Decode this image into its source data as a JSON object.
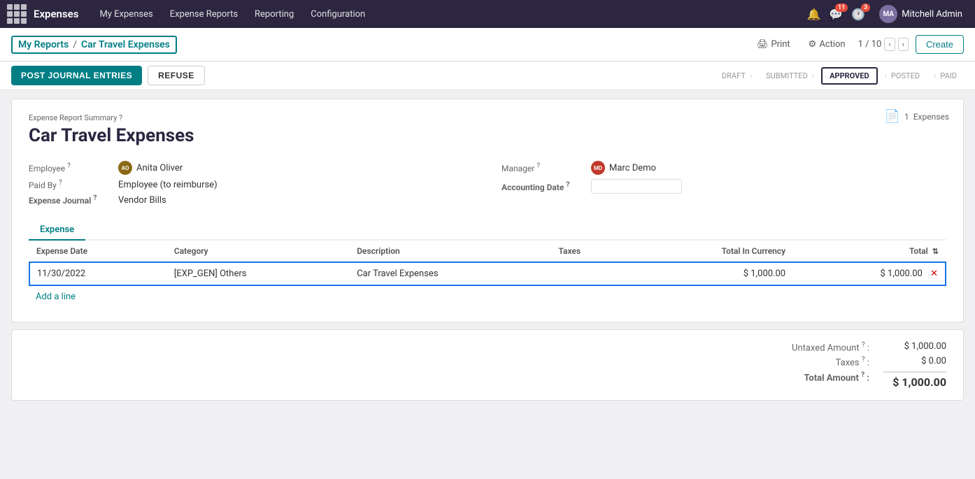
{
  "app": {
    "name": "Expenses",
    "nav_items": [
      "My Expenses",
      "Expense Reports",
      "Reporting",
      "Configuration"
    ]
  },
  "topbar": {
    "user_name": "Mitchell Admin",
    "user_initials": "MA",
    "chat_count": "11",
    "clock_count": "3"
  },
  "breadcrumb": {
    "parent": "My Reports",
    "separator": "/",
    "current": "Car Travel Expenses"
  },
  "toolbar": {
    "print_label": "Print",
    "action_label": "Action",
    "pager": "1 / 10",
    "create_label": "Create"
  },
  "actions": {
    "post_journal": "POST JOURNAL ENTRIES",
    "refuse": "REFUSE"
  },
  "status_steps": [
    "DRAFT",
    "SUBMITTED",
    "APPROVED",
    "POSTED",
    "PAID"
  ],
  "active_step": "APPROVED",
  "form": {
    "subtitle": "Expense Report Summary ?",
    "title": "Car Travel Expenses",
    "doc_count": "1",
    "doc_label": "Expenses",
    "fields": {
      "employee_label": "Employee",
      "employee_value": "Anita Oliver",
      "employee_initials": "AO",
      "paid_by_label": "Paid By",
      "paid_by_value": "Employee (to reimburse)",
      "expense_journal_label": "Expense Journal",
      "expense_journal_value": "Vendor Bills",
      "manager_label": "Manager",
      "manager_value": "Marc Demo",
      "manager_initials": "MD",
      "accounting_date_label": "Accounting Date"
    }
  },
  "tabs": [
    {
      "label": "Expense",
      "active": true
    }
  ],
  "table": {
    "columns": [
      "Expense Date",
      "Category",
      "Description",
      "Taxes",
      "Total In Currency",
      "Total"
    ],
    "rows": [
      {
        "date": "11/30/2022",
        "category": "[EXP_GEN] Others",
        "description": "Car Travel Expenses",
        "taxes": "",
        "total_in_currency": "$ 1,000.00",
        "total": "$ 1,000.00"
      }
    ],
    "add_line_label": "Add a line"
  },
  "summary": {
    "untaxed_label": "Untaxed Amount",
    "untaxed_value": "$ 1,000.00",
    "taxes_label": "Taxes",
    "taxes_value": "$ 0.00",
    "total_label": "Total Amount",
    "total_value": "$ 1,000.00"
  }
}
